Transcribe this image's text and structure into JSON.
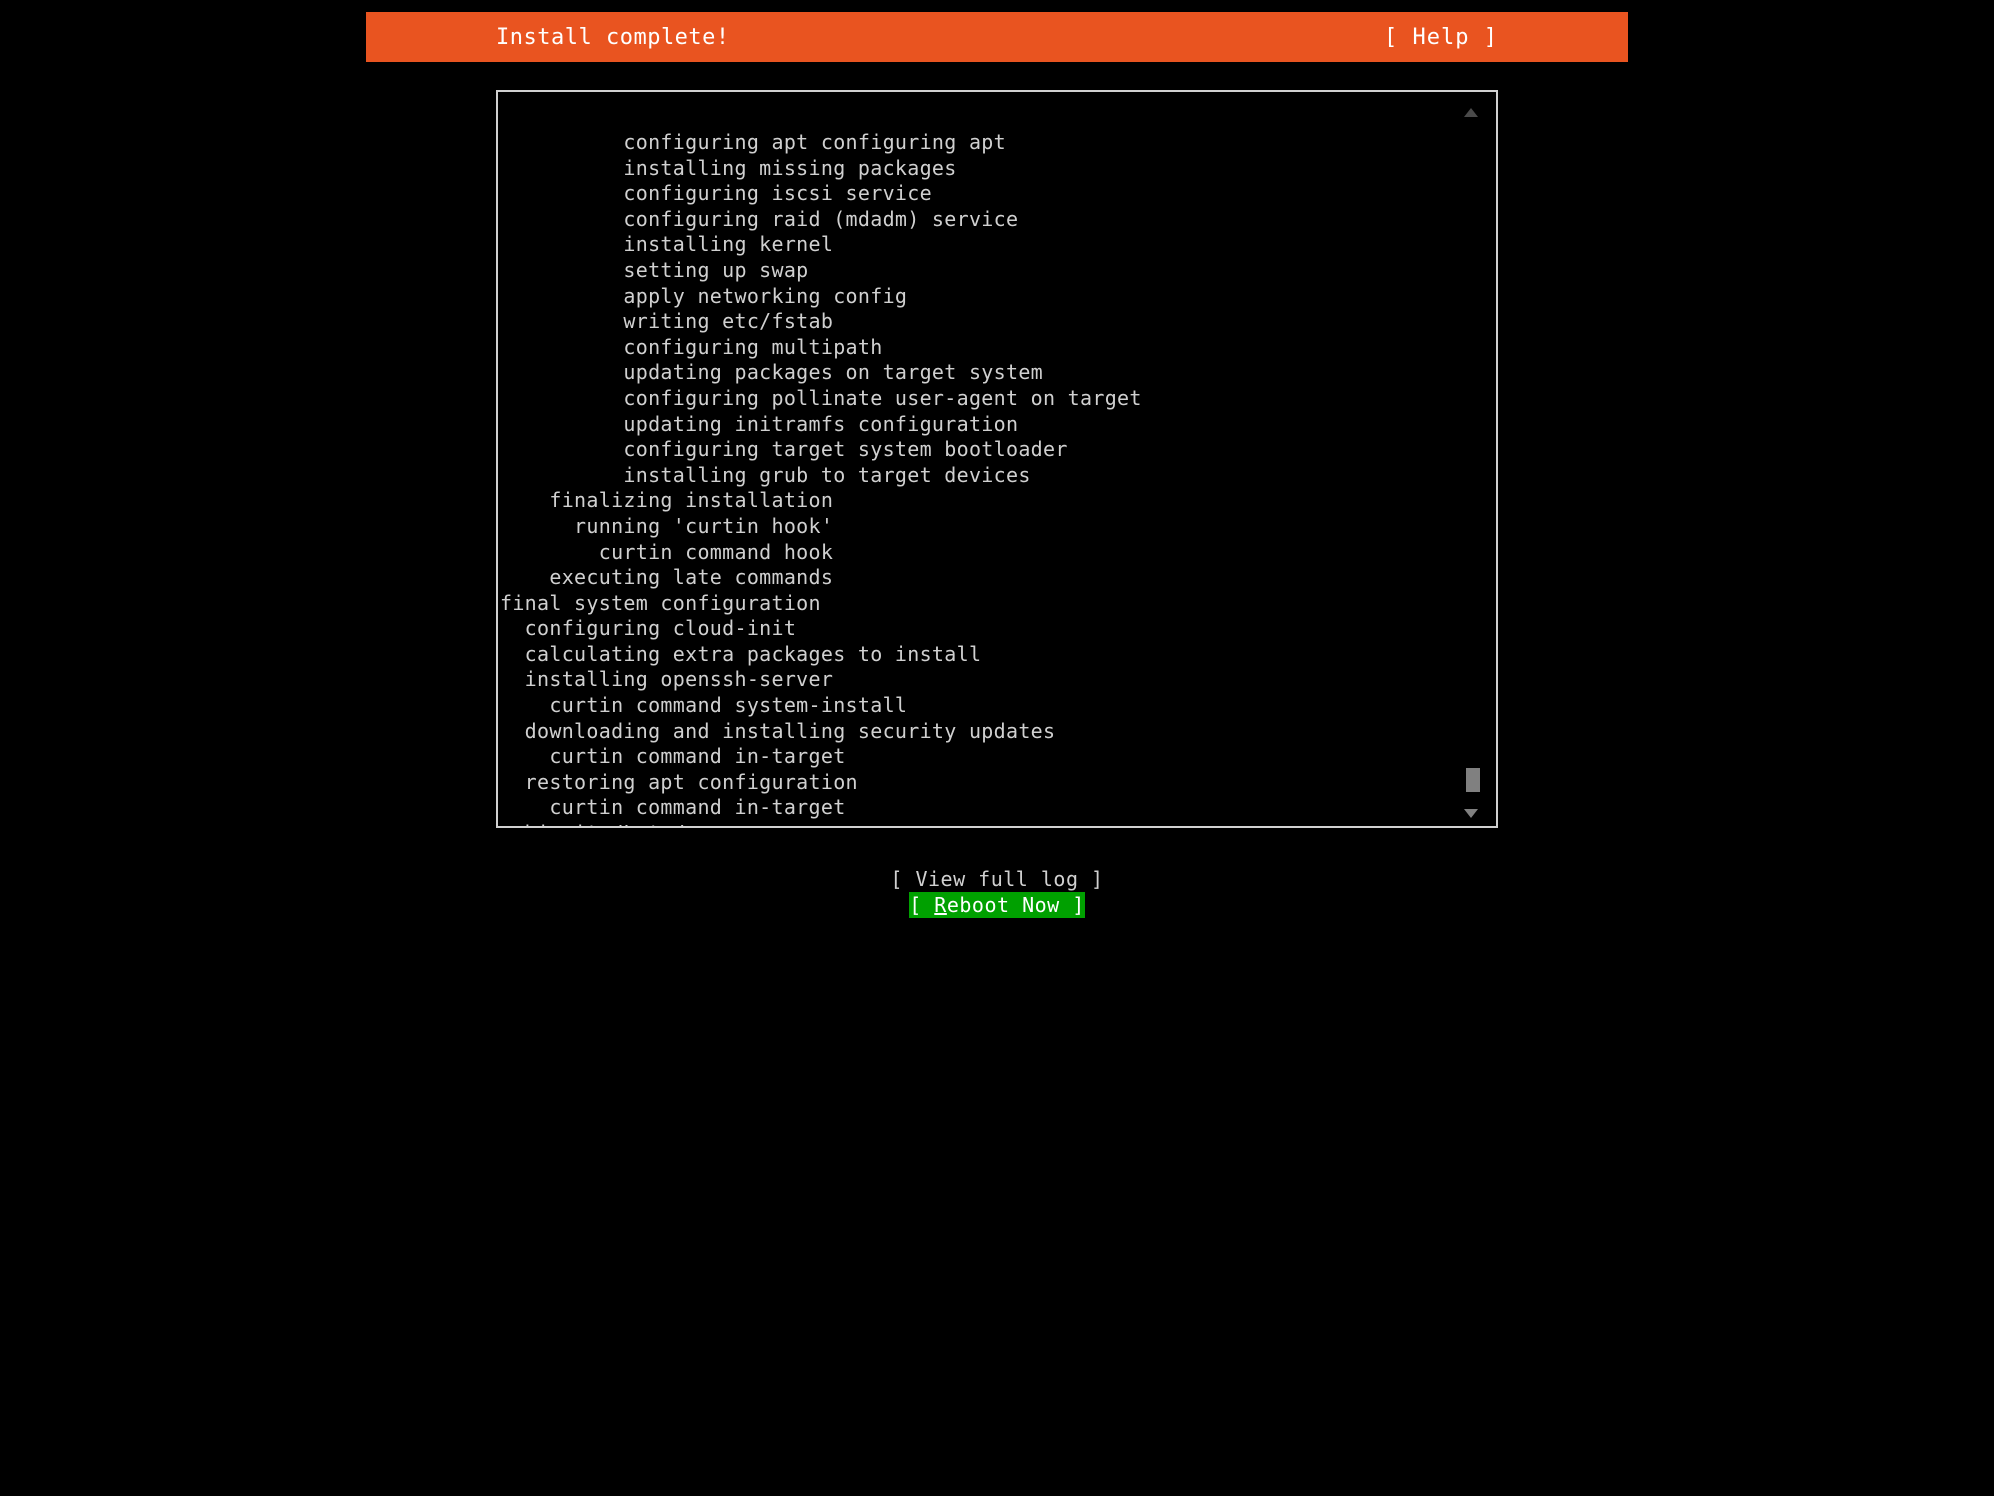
{
  "header": {
    "title": "Install complete!",
    "help_label": "[ Help ]"
  },
  "log": {
    "lines": [
      "          configuring apt configuring apt",
      "          installing missing packages",
      "          configuring iscsi service",
      "          configuring raid (mdadm) service",
      "          installing kernel",
      "          setting up swap",
      "          apply networking config",
      "          writing etc/fstab",
      "          configuring multipath",
      "          updating packages on target system",
      "          configuring pollinate user-agent on target",
      "          updating initramfs configuration",
      "          configuring target system bootloader",
      "          installing grub to target devices",
      "    finalizing installation",
      "      running 'curtin hook'",
      "        curtin command hook",
      "    executing late commands",
      "final system configuration",
      "  configuring cloud-init",
      "  calculating extra packages to install",
      "  installing openssh-server",
      "    curtin command system-install",
      "  downloading and installing security updates",
      "    curtin command in-target",
      "  restoring apt configuration",
      "    curtin command in-target",
      "subiquity/Late/run"
    ]
  },
  "buttons": {
    "view_full_log": "[ View full log ]",
    "reboot_open": "[ ",
    "reboot_u": "R",
    "reboot_rest": "eboot Now   ]"
  },
  "colors": {
    "accent": "#E95420",
    "highlight": "#00A000"
  }
}
